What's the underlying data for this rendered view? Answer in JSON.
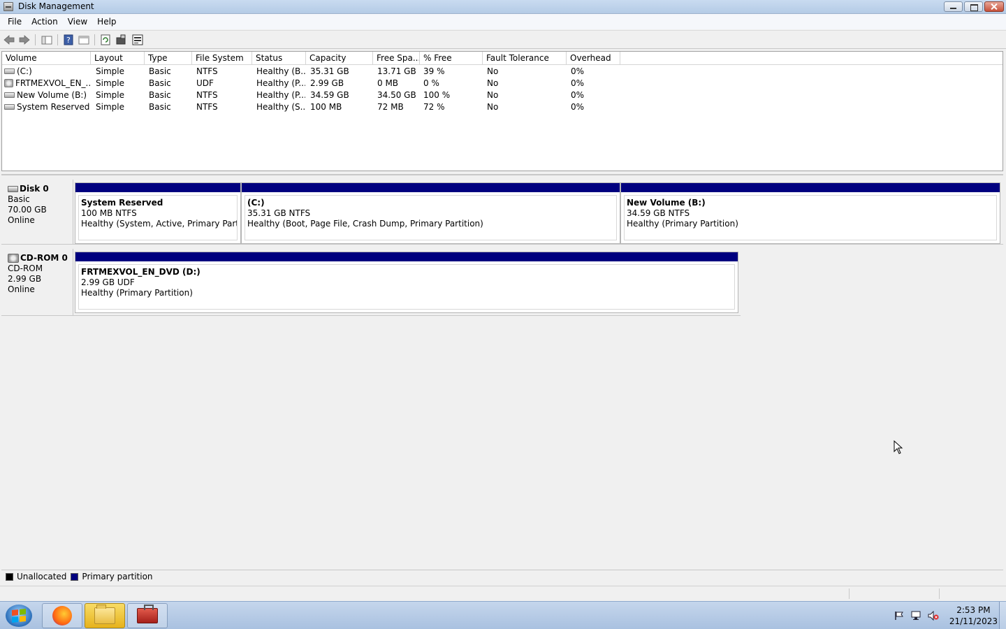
{
  "window": {
    "title": "Disk Management"
  },
  "menu": [
    "File",
    "Action",
    "View",
    "Help"
  ],
  "toolbar": [
    "back-icon",
    "forward-icon",
    "console-tree-icon",
    "help-icon",
    "properties-icon",
    "refresh-icon",
    "settings-icon",
    "rescan-icon"
  ],
  "volume_list": {
    "columns": [
      "Volume",
      "Layout",
      "Type",
      "File System",
      "Status",
      "Capacity",
      "Free Spa...",
      "% Free",
      "Fault Tolerance",
      "Overhead"
    ],
    "rows": [
      {
        "volume": "(C:)",
        "layout": "Simple",
        "type": "Basic",
        "fs": "NTFS",
        "status": "Healthy (B...",
        "capacity": "35.31 GB",
        "free": "13.71 GB",
        "pct_free": "39 %",
        "fault": "No",
        "overhead": "0%",
        "icon": "drive-icon"
      },
      {
        "volume": "FRTMEXVOL_EN_...",
        "layout": "Simple",
        "type": "Basic",
        "fs": "UDF",
        "status": "Healthy (P...",
        "capacity": "2.99 GB",
        "free": "0 MB",
        "pct_free": "0 %",
        "fault": "No",
        "overhead": "0%",
        "icon": "cd-icon"
      },
      {
        "volume": "New Volume (B:)",
        "layout": "Simple",
        "type": "Basic",
        "fs": "NTFS",
        "status": "Healthy (P...",
        "capacity": "34.59 GB",
        "free": "34.50 GB",
        "pct_free": "100 %",
        "fault": "No",
        "overhead": "0%",
        "icon": "drive-icon"
      },
      {
        "volume": "System Reserved",
        "layout": "Simple",
        "type": "Basic",
        "fs": "NTFS",
        "status": "Healthy (S...",
        "capacity": "100 MB",
        "free": "72 MB",
        "pct_free": "72 %",
        "fault": "No",
        "overhead": "0%",
        "icon": "drive-icon"
      }
    ]
  },
  "disks": [
    {
      "name": "Disk 0",
      "type": "Basic",
      "size": "70.00 GB",
      "state": "Online",
      "partitions": [
        {
          "name": "System Reserved",
          "fs": "100 MB NTFS",
          "status": "Healthy (System, Active, Primary Partition)"
        },
        {
          "name": "(C:)",
          "fs": "35.31 GB NTFS",
          "status": "Healthy (Boot, Page File, Crash Dump, Primary Partition)"
        },
        {
          "name": "New Volume  (B:)",
          "fs": "34.59 GB NTFS",
          "status": "Healthy (Primary Partition)"
        }
      ]
    },
    {
      "name": "CD-ROM 0",
      "type": "CD-ROM",
      "size": "2.99 GB",
      "state": "Online",
      "partitions": [
        {
          "name": "FRTMEXVOL_EN_DVD  (D:)",
          "fs": "2.99 GB UDF",
          "status": "Healthy (Primary Partition)"
        }
      ]
    }
  ],
  "legend": [
    {
      "label": "Unallocated",
      "color": "#000000"
    },
    {
      "label": "Primary partition",
      "color": "#00007f"
    }
  ],
  "taskbar": {
    "apps": [
      "firefox-icon",
      "explorer-icon",
      "computer-management-icon"
    ],
    "clock_time": "2:53 PM",
    "clock_date": "21/11/2023"
  }
}
